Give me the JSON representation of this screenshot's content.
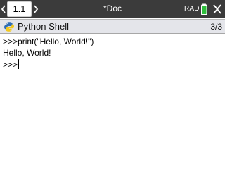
{
  "header": {
    "tab_label": "1.1",
    "document_title": "*Doc",
    "angle_mode": "RAD",
    "left_arrow_icon": "left-arrow-icon",
    "right_arrow_icon": "right-arrow-icon",
    "battery_icon": "battery-icon",
    "close_icon": "close-icon"
  },
  "app": {
    "title": "Python Shell",
    "page_indicator": "3/3",
    "icon": "python-icon"
  },
  "console": {
    "lines": [
      {
        "prompt": ">>>",
        "text": "print(\"Hello, World!\")"
      },
      {
        "prompt": "",
        "text": "Hello, World!"
      },
      {
        "prompt": ">>>",
        "text": ""
      }
    ]
  },
  "colors": {
    "topbar": "#3b3b3b",
    "appbar": "#e4e5ea",
    "battery": "#2fbf3d",
    "python_blue": "#2f6db5",
    "python_yellow": "#f2c81e"
  }
}
